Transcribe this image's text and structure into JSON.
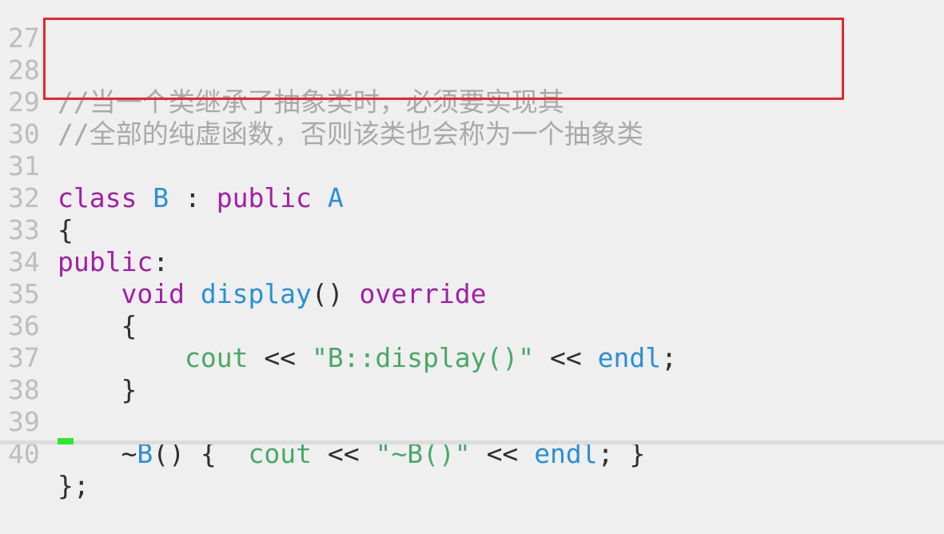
{
  "editor": {
    "line_numbers": [
      "27",
      "28",
      "29",
      "30",
      "31",
      "32",
      "33",
      "34",
      "35",
      "36",
      "37",
      "38",
      "39",
      "40"
    ],
    "comment_line_1": "//当一个类继承了抽象类时，必须要实现其",
    "comment_line_2": "//全部的纯虚函数，否则该类也会称为一个抽象类",
    "kw_class": "class",
    "class_name_b": "B",
    "colon": ":",
    "kw_public": "public",
    "base_class_a": "A",
    "open_brace": "{",
    "kw_public_label": "public",
    "label_colon": ":",
    "kw_void": "void",
    "fn_display": "display",
    "parens": "()",
    "kw_override": "override",
    "inner_open_brace": "{",
    "cout": "cout",
    "shift": "<<",
    "str_display": "\"B::display()\"",
    "endl": "endl",
    "semicolon": ";",
    "inner_close_brace": "}",
    "tilde": "~",
    "dtor_name": "B",
    "dtor_parens": "()",
    "dtor_open": "{",
    "str_dtor": "\"~B()\"",
    "dtor_close": "}",
    "class_close": "};"
  },
  "colors": {
    "keyword": "#a11fa6",
    "type": "#2b8fd6",
    "identifier": "#4aa866",
    "comment": "#a9a9a9",
    "line_number": "#bdbdbd",
    "highlight_box": "#e5282e",
    "cursor": "#2ee72e"
  }
}
